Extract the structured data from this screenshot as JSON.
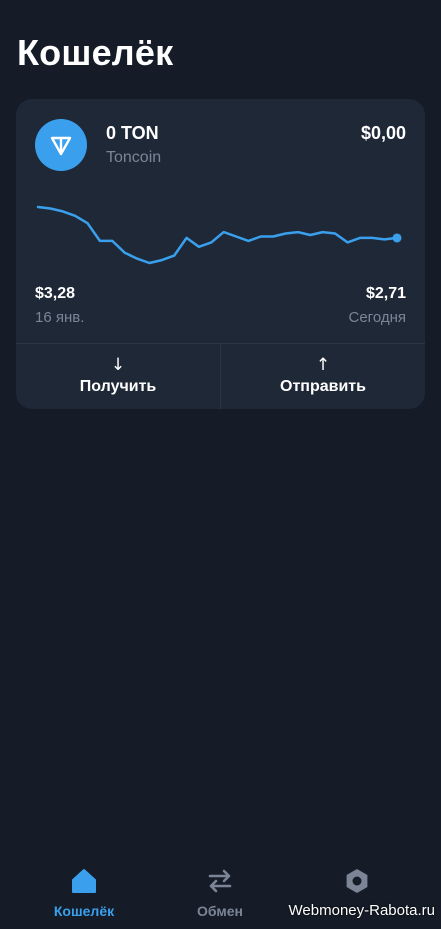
{
  "page": {
    "title": "Кошелёк"
  },
  "wallet_card": {
    "token_amount": "0 TON",
    "token_name": "Toncoin",
    "token_value": "$0,00",
    "start_price": "$3,28",
    "start_date": "16 янв.",
    "end_price": "$2,71",
    "end_date": "Сегодня",
    "avatar_icon": "toncoin-logo-icon",
    "avatar_color": "#3aa0ee",
    "line_color": "#3aa0ee"
  },
  "chart_data": {
    "type": "line",
    "series": [
      {
        "values": [
          3.28,
          3.27,
          3.25,
          3.22,
          3.17,
          3.05,
          3.05,
          2.97,
          2.93,
          2.9,
          2.92,
          2.95,
          3.07,
          3.01,
          3.04,
          3.11,
          3.08,
          3.05,
          3.08,
          3.08,
          3.1,
          3.11,
          3.09,
          3.11,
          3.1,
          3.04,
          3.07,
          3.07,
          3.06,
          3.07
        ]
      }
    ],
    "x_start_label": "16 янв.",
    "x_end_label": "Сегодня",
    "grid": false
  },
  "actions": {
    "receive_label": "Получить",
    "receive_icon": "↓",
    "send_label": "Отправить",
    "send_icon": "↑"
  },
  "tab_bar": {
    "wallet_label": "Кошелёк",
    "swap_label": "Обмен",
    "active_color": "#3aa0ee",
    "inactive_color": "#7b8595"
  },
  "watermark": "Webmoney-Rabota.ru"
}
